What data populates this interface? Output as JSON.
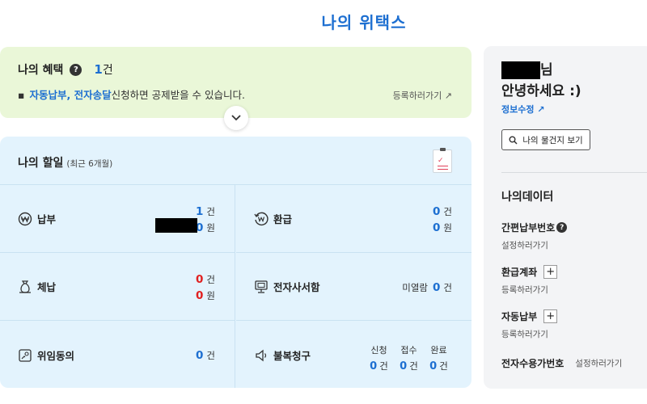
{
  "page_title": "나의 위택스",
  "benefit": {
    "title": "나의 혜택",
    "help_icon": "?",
    "count": "1",
    "count_unit": "건",
    "bullet": "▪",
    "link_text": "자동납부, 전자송달",
    "desc_text": "신청하면 공제받을 수 있습니다.",
    "register_label": "등록하러가기 ↗"
  },
  "expand_icon": "chevron-down-icon",
  "discount": {
    "title": "나의 할일",
    "subtitle": "(최근 6개월)",
    "items": {
      "payment": {
        "label": "납부",
        "count": "1",
        "count_unit": "건",
        "amount": "0",
        "amount_unit": "원"
      },
      "refund": {
        "label": "환급",
        "count": "0",
        "count_unit": "건",
        "amount": "0",
        "amount_unit": "원"
      },
      "arrears": {
        "label": "체납",
        "count": "0",
        "count_unit": "건",
        "amount": "0",
        "amount_unit": "원"
      },
      "e_notice": {
        "label": "전자사서함",
        "prefix": "미열람",
        "count": "0",
        "count_unit": "건"
      },
      "delegation": {
        "label": "위임동의",
        "count": "0",
        "count_unit": "건"
      },
      "objection": {
        "label": "불복청구",
        "cols": [
          {
            "head": "신청",
            "count": "0",
            "unit": "건"
          },
          {
            "head": "접수",
            "count": "0",
            "unit": "건"
          },
          {
            "head": "완료",
            "count": "0",
            "unit": "건"
          }
        ]
      }
    }
  },
  "side": {
    "name_suffix": "님",
    "greeting": "안녕하세요 :)",
    "edit_info": "정보수정 ↗",
    "mailbox_button": "나의 물건지 보기",
    "data_title": "나의데이터",
    "data_items": [
      {
        "label": "간편납부번호",
        "action": "설정하러가기"
      },
      {
        "label": "환급계좌",
        "action": "등록하러가기"
      },
      {
        "label": "자동납부",
        "action": "등록하러가기"
      },
      {
        "label": "전자수용가번호",
        "action": "설정하러가기"
      }
    ]
  },
  "colors": {
    "accent": "#1d6fd1",
    "alert": "#e02020",
    "benefit_bg": "#eaf7d8",
    "todo_bg": "#e3f3fd"
  }
}
